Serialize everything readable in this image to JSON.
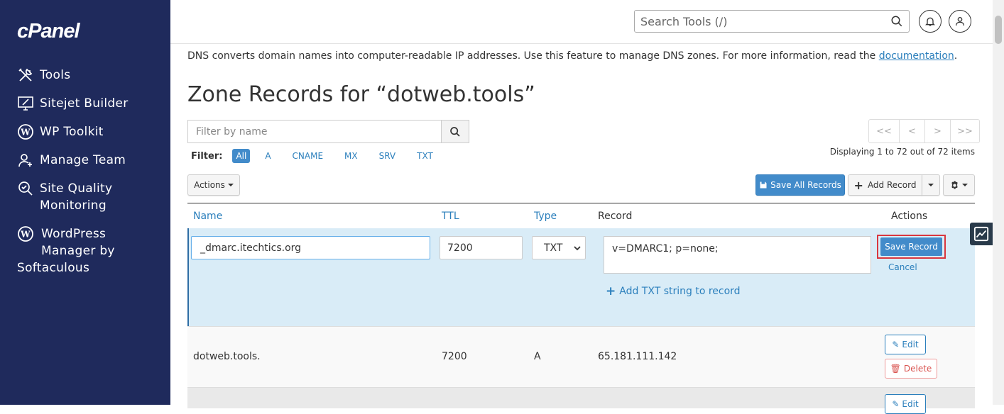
{
  "sidebar": {
    "logo": "cPanel",
    "items": [
      {
        "label": "Tools",
        "icon": "tools-icon"
      },
      {
        "label": "Sitejet Builder",
        "icon": "sitejet-icon"
      },
      {
        "label": "WP Toolkit",
        "icon": "wordpress-icon"
      },
      {
        "label": "Manage Team",
        "icon": "team-icon"
      },
      {
        "label_line1": "Site Quality",
        "label_line2": "Monitoring",
        "icon": "site-quality-icon"
      },
      {
        "label_line1": "WordPress",
        "label_line2": "Manager by",
        "label_line3": "Softaculous",
        "icon": "wordpress-icon"
      }
    ]
  },
  "topbar": {
    "search_placeholder": "Search Tools (/)"
  },
  "intro": {
    "text": "DNS converts domain names into computer-readable IP addresses. Use this feature to manage DNS zones. For more information, read the ",
    "link": "documentation",
    "end": "."
  },
  "title": "Zone Records for “dotweb.tools”",
  "filter": {
    "placeholder": "Filter by name",
    "label": "Filter:",
    "types": [
      "All",
      "A",
      "CNAME",
      "MX",
      "SRV",
      "TXT"
    ],
    "active": "All"
  },
  "pager": {
    "buttons": [
      "<<",
      "<",
      ">",
      ">>"
    ],
    "displaying": "Displaying 1 to 72 out of 72 items"
  },
  "toolbar": {
    "actions_label": "Actions",
    "save_all_label": "Save All Records",
    "add_record_label": "Add Record"
  },
  "table": {
    "headers": {
      "name": "Name",
      "ttl": "TTL",
      "type": "Type",
      "record": "Record",
      "actions": "Actions"
    }
  },
  "edit_row": {
    "name": "_dmarc.itechtics.org",
    "ttl": "7200",
    "type": "TXT",
    "record": "v=DMARC1; p=none;",
    "add_txt_label": "Add TXT string to record",
    "save_label": "Save Record",
    "cancel_label": "Cancel"
  },
  "rows": [
    {
      "name": "dotweb.tools.",
      "ttl": "7200",
      "type": "A",
      "record": "65.181.111.142",
      "edit_label": "Edit",
      "delete_label": "Delete"
    },
    {
      "edit_label": "Edit"
    }
  ],
  "colors": {
    "sidebar_bg": "#1f2a5c",
    "primary": "#428bca",
    "link": "#2b7fbc",
    "highlight_border": "#d9363e",
    "edit_row_bg": "#d9ecf7"
  }
}
